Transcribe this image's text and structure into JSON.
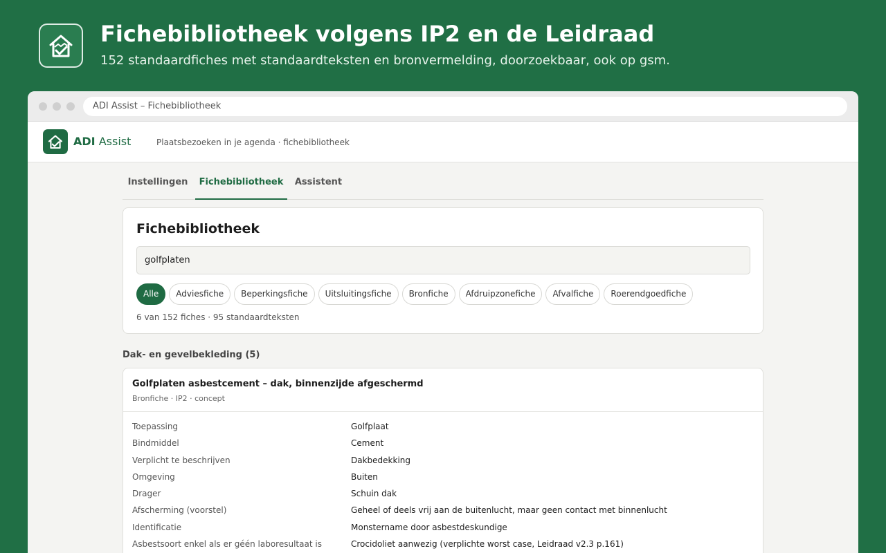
{
  "hero": {
    "title": "Fichebibliotheek volgens IP2 en de Leidraad",
    "subtitle": "152 standaardfiches met standaardteksten en bronvermelding, doorzoekbaar, ook op gsm."
  },
  "browser": {
    "url": "ADI Assist – Fichebibliotheek"
  },
  "app": {
    "brand_bold": "ADI",
    "brand_light": " Assist",
    "tagline": "Plaatsbezoeken in je agenda · fichebibliotheek"
  },
  "tabs": [
    {
      "label": "Instellingen"
    },
    {
      "label": "Fichebibliotheek"
    },
    {
      "label": "Assistent"
    }
  ],
  "library": {
    "title": "Fichebibliotheek",
    "search_value": "golfplaten",
    "filters": [
      {
        "label": "Alle"
      },
      {
        "label": "Adviesfiche"
      },
      {
        "label": "Beperkingsfiche"
      },
      {
        "label": "Uitsluitingsfiche"
      },
      {
        "label": "Bronfiche"
      },
      {
        "label": "Afdruipzonefiche"
      },
      {
        "label": "Afvalfiche"
      },
      {
        "label": "Roerendgoedfiche"
      }
    ],
    "count": "6 van 152 fiches · 95 standaardteksten"
  },
  "group": {
    "title": "Dak- en gevelbekleding (5)"
  },
  "fiche": {
    "title": "Golfplaten asbestcement – dak, binnenzijde afgeschermd",
    "meta": "Bronfiche · IP2 · concept",
    "properties": [
      {
        "key": "Toepassing",
        "value": "Golfplaat"
      },
      {
        "key": "Bindmiddel",
        "value": "Cement"
      },
      {
        "key": "Verplicht te beschrijven",
        "value": "Dakbedekking"
      },
      {
        "key": "Omgeving",
        "value": "Buiten"
      },
      {
        "key": "Drager",
        "value": "Schuin dak"
      },
      {
        "key": "Afscherming (voorstel)",
        "value": "Geheel of deels vrij aan de buitenlucht, maar geen contact met binnenlucht"
      },
      {
        "key": "Identificatie",
        "value": "Monstername door asbestdeskundige"
      },
      {
        "key": "Asbestsoort enkel als er géén laboresultaat is",
        "value": "Crocidoliet aanwezig (verplichte worst case, Leidraad v2.3 p.161)"
      }
    ]
  },
  "colors": {
    "brand_green": "#1f6b43",
    "background_green": "#206f45"
  }
}
